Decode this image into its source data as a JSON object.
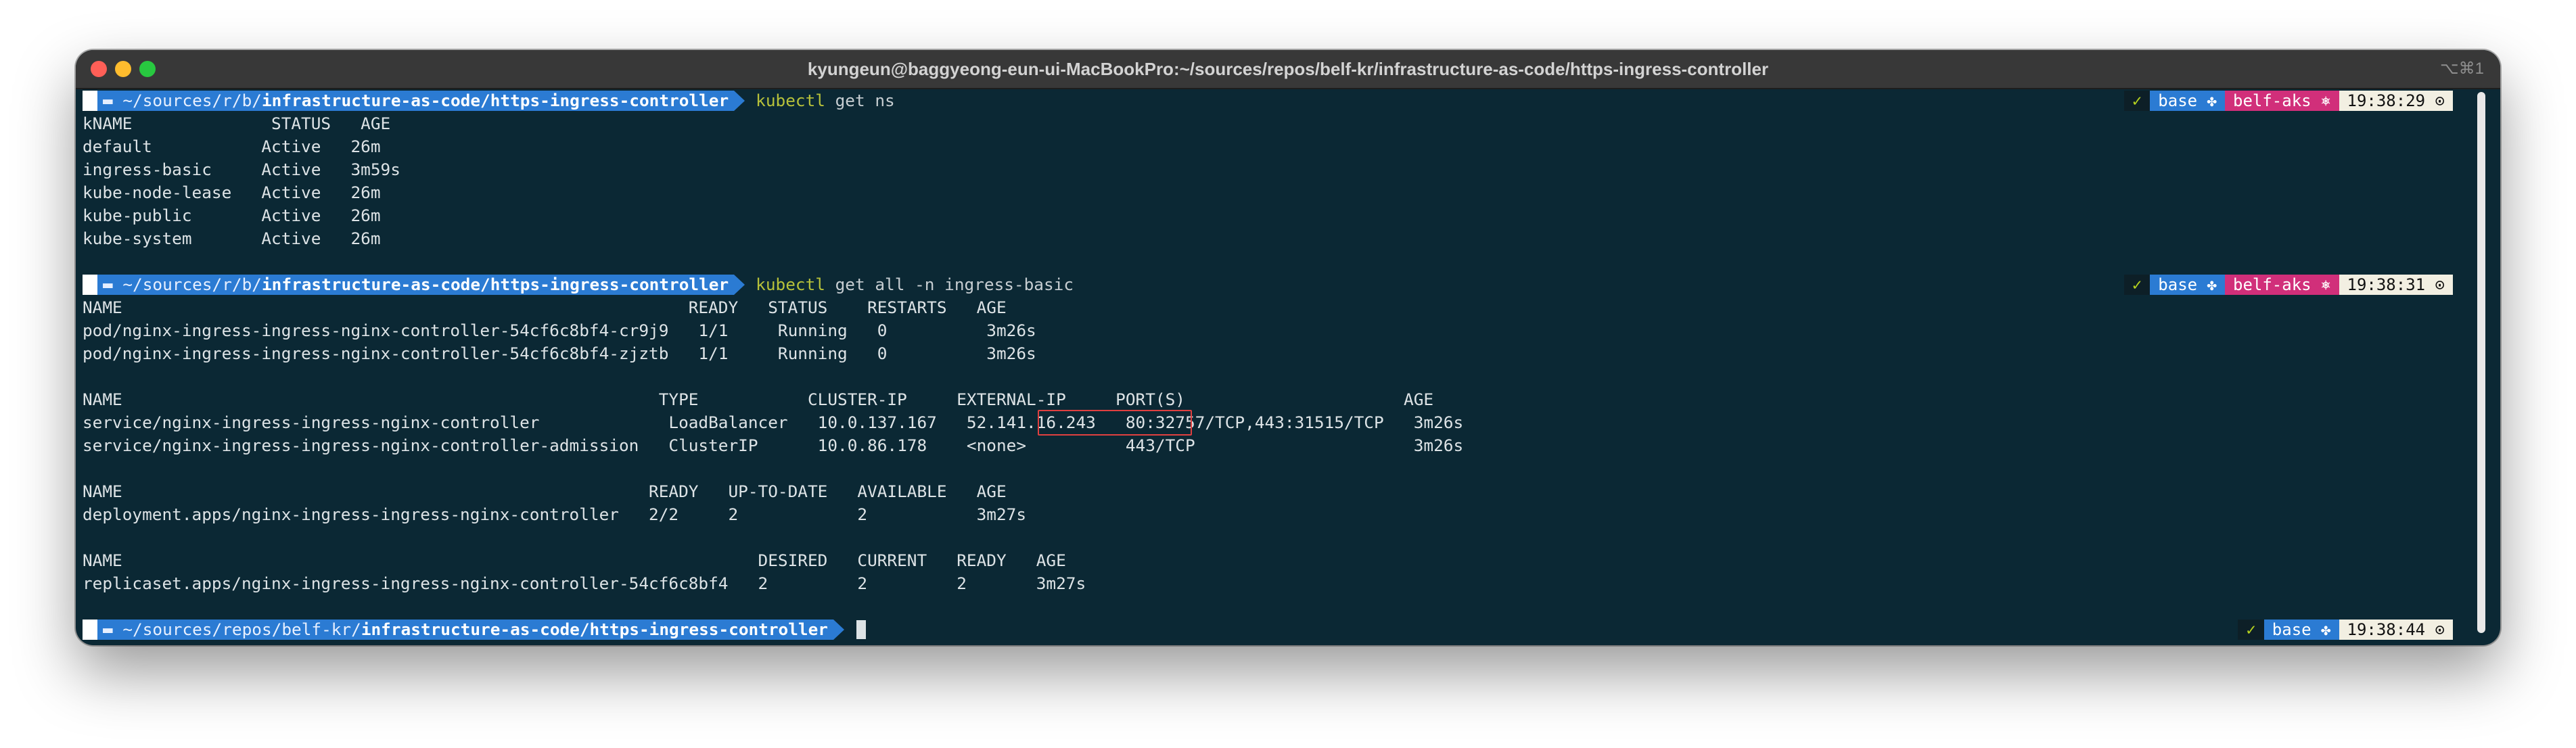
{
  "window": {
    "title": "kyungeun@baggyeong-eun-ui-MacBookPro:~/sources/repos/belf-kr/infrastructure-as-code/https-ingress-controller",
    "shortcut": "⌥⌘1"
  },
  "prompts": [
    {
      "apple_icon": "",
      "path_prefix": "~/sources/r/b/",
      "path_dir": "infrastructure-as-code/https-ingress-controller",
      "command": "kubectl",
      "args": " get ns",
      "status_ok": "✓",
      "env": "base ✤",
      "context": "belf-aks ⎈",
      "time": "19:38:29 ⊙"
    },
    {
      "apple_icon": "",
      "path_prefix": "~/sources/r/b/",
      "path_dir": "infrastructure-as-code/https-ingress-controller",
      "command": "kubectl",
      "args": " get all -n ingress-basic",
      "status_ok": "✓",
      "env": "base ✤",
      "context": "belf-aks ⎈",
      "time": "19:38:31 ⊙"
    },
    {
      "apple_icon": "",
      "path_prefix": "~/sources/repos/belf-kr/",
      "path_dir": "infrastructure-as-code/https-ingress-controller",
      "command": "",
      "args": "",
      "status_ok": "✓",
      "env": "base ✤",
      "context": "",
      "time": "19:38:44 ⊙"
    }
  ],
  "ns_output": [
    "kNAME              STATUS   AGE",
    "default           Active   26m",
    "ingress-basic     Active   3m59s",
    "kube-node-lease   Active   26m",
    "kube-public       Active   26m",
    "kube-system       Active   26m"
  ],
  "all_output": [
    "NAME                                                         READY   STATUS    RESTARTS   AGE",
    "pod/nginx-ingress-ingress-nginx-controller-54cf6c8bf4-cr9j9   1/1     Running   0          3m26s",
    "pod/nginx-ingress-ingress-nginx-controller-54cf6c8bf4-zjztb   1/1     Running   0          3m26s",
    "",
    "NAME                                                      TYPE           CLUSTER-IP     EXTERNAL-IP     PORT(S)                      AGE",
    "service/nginx-ingress-ingress-nginx-controller             LoadBalancer   10.0.137.167   52.141.16.243   80:32757/TCP,443:31515/TCP   3m26s",
    "service/nginx-ingress-ingress-nginx-controller-admission   ClusterIP      10.0.86.178    <none>          443/TCP                      3m26s",
    "",
    "NAME                                                     READY   UP-TO-DATE   AVAILABLE   AGE",
    "deployment.apps/nginx-ingress-ingress-nginx-controller   2/2     2            2           3m27s",
    "",
    "NAME                                                                DESIRED   CURRENT   READY   AGE",
    "replicaset.apps/nginx-ingress-ingress-nginx-controller-54cf6c8bf4   2         2         2       3m27s"
  ],
  "colors": {
    "terminal_bg": "#0b2834",
    "path_segment": "#2b7bd3",
    "context_segment": "#d12f7a",
    "command": "#b7c13a",
    "highlight_box": "#e04040"
  }
}
